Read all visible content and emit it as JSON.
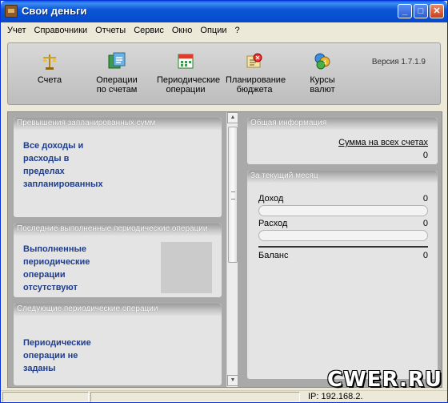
{
  "window": {
    "title": "Свои деньги",
    "buttons": {
      "minimize": "_",
      "maximize": "□",
      "close": "✕"
    }
  },
  "menu": [
    "Учет",
    "Справочники",
    "Отчеты",
    "Сервис",
    "Окно",
    "Опции",
    "?"
  ],
  "toolbar": {
    "items": [
      {
        "label": "Счета",
        "icon": "scales-icon"
      },
      {
        "label": "Операции\nпо счетам",
        "icon": "accounts-operations-icon"
      },
      {
        "label": "Периодические\nоперации",
        "icon": "calendar-icon"
      },
      {
        "label": "Планирование\nбюджета",
        "icon": "budget-planning-icon"
      },
      {
        "label": "Курсы\nвалют",
        "icon": "currency-coins-icon"
      }
    ],
    "version": "Версия 1.7.1.9"
  },
  "left_panels": {
    "exceeded": {
      "title": "Превышения запланированных сумм",
      "text": "Все доходы и\nрасходы в\nпределах\nзапланированных"
    },
    "last_periodic": {
      "title": "Последние выполненные периодические операции",
      "text": "Выполненные\nпериодические\nоперации\nотсутствуют"
    },
    "next_periodic": {
      "title": "Следующие периодические операции",
      "text": "Периодические\nоперации не\nзаданы"
    }
  },
  "right_panels": {
    "general": {
      "title": "Общая информация",
      "total_label": "Сумма на всех счетах",
      "total_value": "0"
    },
    "month": {
      "title": "За текущий месяц",
      "income_label": "Доход",
      "income_value": "0",
      "expense_label": "Расход",
      "expense_value": "0",
      "balance_label": "Баланс",
      "balance_value": "0"
    }
  },
  "statusbar": {
    "ip": "IP: 192.168.2."
  },
  "watermark": "CWER.RU"
}
